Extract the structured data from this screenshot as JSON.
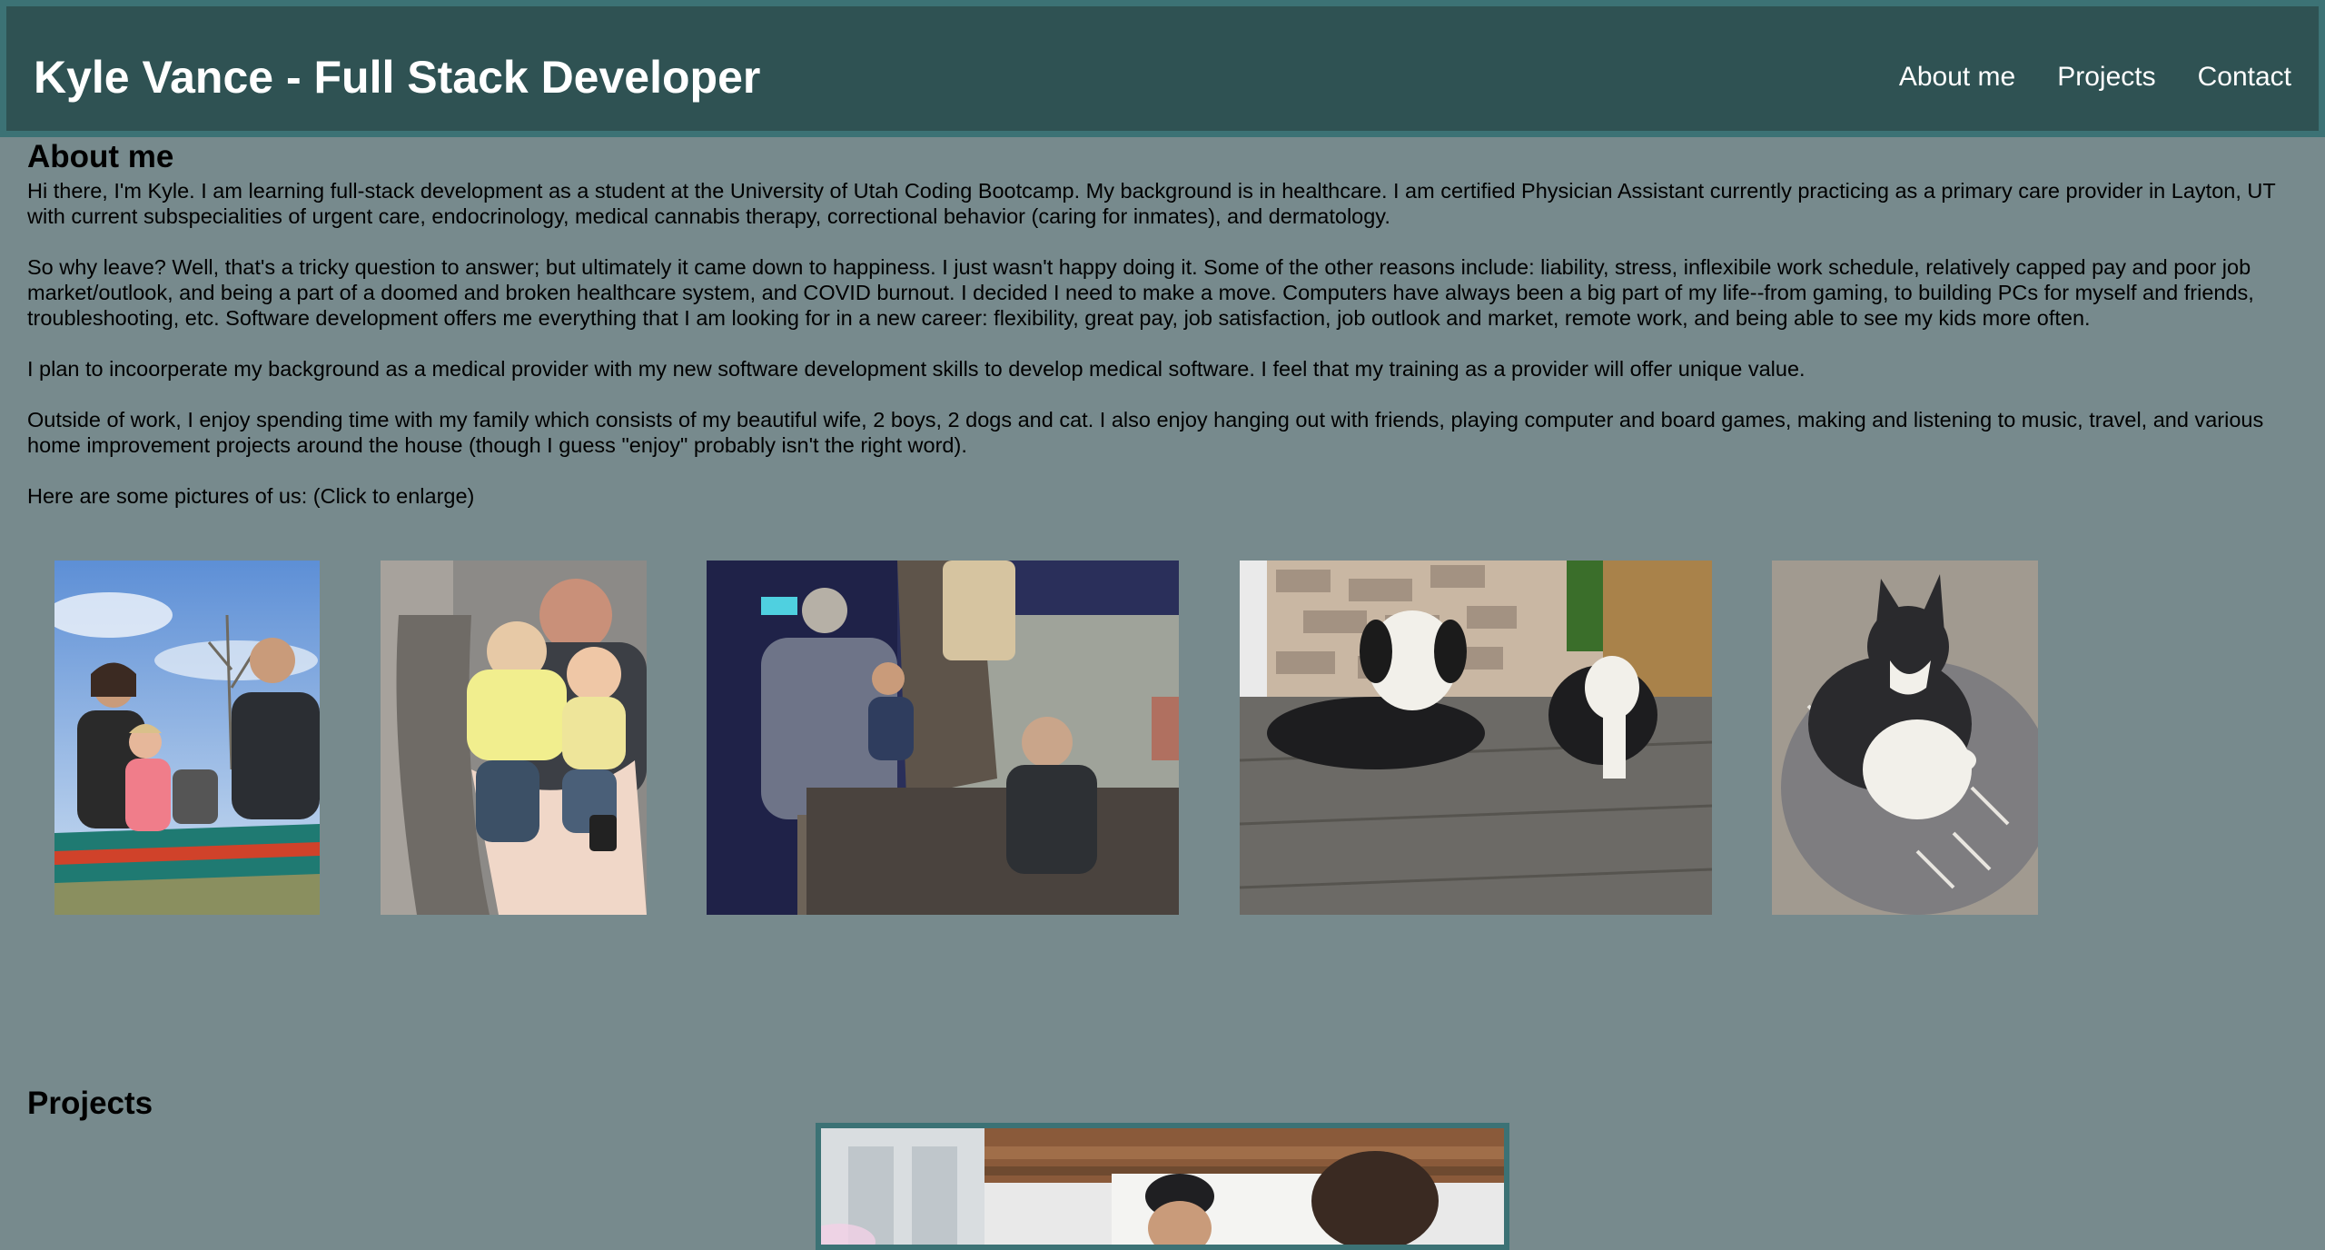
{
  "header": {
    "title": "Kyle Vance - Full Stack Developer",
    "nav": [
      "About me",
      "Projects",
      "Contact"
    ]
  },
  "about": {
    "heading": "About me",
    "paragraphs": [
      "Hi there, I'm Kyle. I am learning full-stack development as a student at the University of Utah Coding Bootcamp. My background is in healthcare. I am certified Physician Assistant currently practicing as a primary care provider in Layton, UT with current subspecialities of urgent care, endocrinology, medical cannabis therapy, correctional behavior (caring for inmates), and dermatology.",
      "So why leave? Well, that's a tricky question to answer; but ultimately it came down to happiness. I just wasn't happy doing it. Some of the other reasons include: liability, stress, inflexibile work schedule, relatively capped pay and poor job market/outlook, and being a part of a doomed and broken healthcare system, and COVID burnout. I decided I need to make a move. Computers have always been a big part of my life--from gaming, to building PCs for myself and friends, troubleshooting, etc. Software development offers me everything that I am looking for in a new career: flexibility, great pay, job satisfaction, job outlook and market, remote work, and being able to see my kids more often.",
      "I plan to incoorperate my background as a medical provider with my new software development skills to develop medical software. I feel that my training as a provider will offer unique value.",
      "Outside of work, I enjoy spending time with my family which consists of my beautiful wife, 2 boys, 2 dogs and cat. I also enjoy hanging out with friends, playing computer and board games, making and listening to music, travel, and various home improvement projects around the house (though I guess \"enjoy\" probably isn't the right word).",
      "Here are some pictures of us: (Click to enlarge)"
    ]
  },
  "projects": {
    "heading": "Projects"
  },
  "colors": {
    "page_bg": "#778a8d",
    "header_bg": "#2f5253",
    "header_border": "#3c7275"
  }
}
